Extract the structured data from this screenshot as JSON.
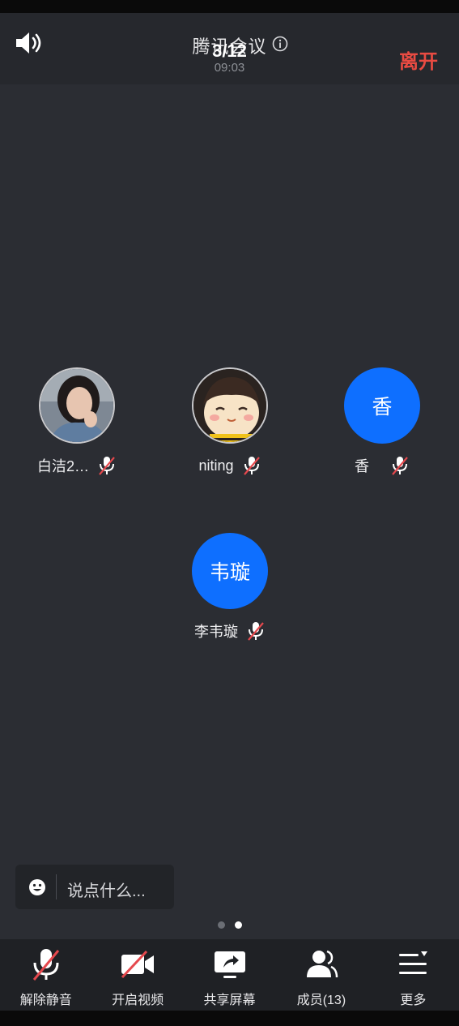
{
  "header": {
    "title": "腾讯会议",
    "overlay_title": "3/12",
    "timer": "09:03",
    "leave_label": "离开"
  },
  "participants": [
    {
      "name": "白洁2…",
      "avatar_type": "photo-woman",
      "muted": true
    },
    {
      "name": "niting",
      "avatar_type": "cartoon-girl",
      "muted": true
    },
    {
      "name": "香",
      "avatar_initials": "香",
      "avatar_type": "initials",
      "muted": true
    },
    {
      "name": "李韦璇",
      "avatar_initials": "韦璇",
      "avatar_type": "initials",
      "muted": true
    }
  ],
  "chat": {
    "placeholder": "说点什么..."
  },
  "pager": {
    "pages": 2,
    "active_index": 1
  },
  "toolbar": {
    "unmute_label": "解除静音",
    "video_label": "开启视频",
    "share_label": "共享屏幕",
    "members_label": "成员(13)",
    "more_label": "更多"
  },
  "colors": {
    "background": "#2b2d33",
    "accent_blue": "#0e6fff",
    "leave_red": "#e94b42",
    "mute_slash": "#e5484d"
  },
  "icons": [
    "speaker-icon",
    "info-icon",
    "mic-muted-icon",
    "emoji-icon",
    "camera-off-icon",
    "share-screen-icon",
    "members-icon",
    "more-icon"
  ]
}
